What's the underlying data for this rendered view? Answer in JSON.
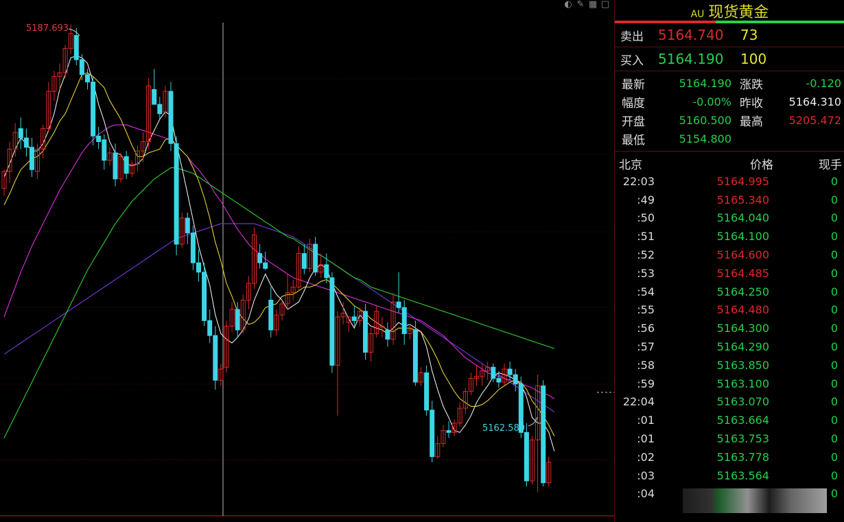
{
  "quote": {
    "symbol_tag": "AU",
    "title": "现货黄金",
    "sell_label": "卖出",
    "sell_price": "5164.740",
    "sell_volume": "73",
    "buy_label": "买入",
    "buy_price": "5164.190",
    "buy_volume": "100",
    "stats": [
      {
        "k": "最新",
        "v": "5164.190",
        "vcolor": "dn",
        "k2": "涨跌",
        "v2": "-0.120",
        "v2color": "dn"
      },
      {
        "k": "幅度",
        "v": "-0.00%",
        "vcolor": "dn",
        "k2": "昨收",
        "v2": "5164.310",
        "v2color": "wh"
      },
      {
        "k": "开盘",
        "v": "5160.500",
        "vcolor": "dn",
        "k2": "最高",
        "v2": "5205.472",
        "v2color": "up"
      },
      {
        "k": "最低",
        "v": "5154.800",
        "vcolor": "dn",
        "k2": "",
        "v2": "",
        "v2color": "wh"
      }
    ],
    "tick_header": {
      "time": "北京",
      "price": "价格",
      "vol": "现手"
    },
    "ticks": [
      {
        "t": "22:03",
        "p": "5164.995",
        "c": "up",
        "v": "0"
      },
      {
        "t": ":49",
        "p": "5165.340",
        "c": "up",
        "v": "0"
      },
      {
        "t": ":50",
        "p": "5164.040",
        "c": "dn",
        "v": "0"
      },
      {
        "t": ":51",
        "p": "5164.100",
        "c": "dn",
        "v": "0"
      },
      {
        "t": ":52",
        "p": "5164.600",
        "c": "up",
        "v": "0"
      },
      {
        "t": ":53",
        "p": "5164.485",
        "c": "up",
        "v": "0"
      },
      {
        "t": ":54",
        "p": "5164.250",
        "c": "dn",
        "v": "0"
      },
      {
        "t": ":55",
        "p": "5164.480",
        "c": "up",
        "v": "0"
      },
      {
        "t": ":56",
        "p": "5164.300",
        "c": "dn",
        "v": "0"
      },
      {
        "t": ":57",
        "p": "5164.290",
        "c": "dn",
        "v": "0"
      },
      {
        "t": ":58",
        "p": "5163.850",
        "c": "dn",
        "v": "0"
      },
      {
        "t": ":59",
        "p": "5163.100",
        "c": "dn",
        "v": "0"
      },
      {
        "t": "22:04",
        "p": "5163.070",
        "c": "dn",
        "v": "0"
      },
      {
        "t": ":01",
        "p": "5163.664",
        "c": "dn",
        "v": "0"
      },
      {
        "t": ":01",
        "p": "5163.753",
        "c": "dn",
        "v": "0"
      },
      {
        "t": ":02",
        "p": "5163.778",
        "c": "dn",
        "v": "0"
      },
      {
        "t": ":03",
        "p": "5163.564",
        "c": "dn",
        "v": "0"
      },
      {
        "t": ":04",
        "p": "",
        "c": "dn",
        "v": "0"
      }
    ]
  },
  "colors": {
    "up": "#e02828",
    "down": "#3cd6e6",
    "ma5": "#e8e8e8",
    "ma10": "#e8d030",
    "ma20": "#e030e0",
    "ma40": "#30d030",
    "ma60": "#7a3ae0"
  },
  "chart_data": {
    "type": "candlestick",
    "high_label": "5187.693",
    "low_label": "5162.580",
    "ylim": [
      5161.4,
      5189.0
    ],
    "candles": [
      [
        5178.9,
        5179.9,
        5178.5,
        5179.8
      ],
      [
        5179.8,
        5181.4,
        5179.2,
        5181.0
      ],
      [
        5181.0,
        5182.4,
        5180.6,
        5181.9
      ],
      [
        5182.1,
        5182.7,
        5181.0,
        5181.6
      ],
      [
        5181.6,
        5182.1,
        5180.6,
        5181.1
      ],
      [
        5181.1,
        5181.6,
        5179.5,
        5179.9
      ],
      [
        5179.8,
        5181.3,
        5179.4,
        5181.0
      ],
      [
        5181.0,
        5182.3,
        5180.5,
        5182.1
      ],
      [
        5182.1,
        5184.6,
        5181.9,
        5184.1
      ],
      [
        5184.1,
        5185.2,
        5183.6,
        5184.9
      ],
      [
        5184.9,
        5185.6,
        5184.2,
        5185.1
      ],
      [
        5185.1,
        5186.6,
        5184.8,
        5186.4
      ],
      [
        5186.4,
        5187.693,
        5186.1,
        5187.2
      ],
      [
        5187.1,
        5187.5,
        5185.5,
        5185.8
      ],
      [
        5185.8,
        5186.1,
        5184.7,
        5185.0
      ],
      [
        5185.0,
        5185.3,
        5184.2,
        5184.6
      ],
      [
        5184.6,
        5184.9,
        5181.2,
        5181.7
      ],
      [
        5181.7,
        5182.2,
        5181.0,
        5181.4
      ],
      [
        5181.5,
        5181.8,
        5179.9,
        5180.4
      ],
      [
        5180.4,
        5181.1,
        5180.1,
        5180.8
      ],
      [
        5180.8,
        5181.3,
        5179.0,
        5179.4
      ],
      [
        5179.4,
        5180.8,
        5179.2,
        5180.6
      ],
      [
        5180.6,
        5180.9,
        5179.4,
        5179.7
      ],
      [
        5179.7,
        5180.4,
        5179.5,
        5180.2
      ],
      [
        5180.2,
        5181.2,
        5179.8,
        5180.9
      ],
      [
        5180.9,
        5181.9,
        5180.3,
        5181.4
      ],
      [
        5181.4,
        5184.8,
        5181.0,
        5184.4
      ],
      [
        5184.2,
        5185.3,
        5183.8,
        5183.4
      ],
      [
        5183.4,
        5183.8,
        5182.6,
        5182.9
      ],
      [
        5183.0,
        5184.4,
        5182.7,
        5184.1
      ],
      [
        5184.1,
        5184.6,
        5180.9,
        5181.3
      ],
      [
        5181.3,
        5181.7,
        5175.3,
        5175.9
      ],
      [
        5175.9,
        5177.6,
        5175.7,
        5177.3
      ],
      [
        5177.3,
        5177.6,
        5175.9,
        5176.5
      ],
      [
        5176.5,
        5176.9,
        5174.5,
        5174.9
      ],
      [
        5174.9,
        5175.6,
        5173.9,
        5174.4
      ],
      [
        5174.4,
        5174.9,
        5171.5,
        5171.8
      ],
      [
        5171.8,
        5172.4,
        5170.6,
        5171.0
      ],
      [
        5171.0,
        5171.5,
        5168.1,
        5168.6
      ],
      [
        5168.6,
        5169.5,
        5168.3,
        5169.2
      ],
      [
        5169.3,
        5171.8,
        5169.0,
        5171.5
      ],
      [
        5171.5,
        5172.8,
        5171.2,
        5172.4
      ],
      [
        5172.4,
        5172.8,
        5170.9,
        5171.3
      ],
      [
        5171.3,
        5173.2,
        5171.1,
        5172.9
      ],
      [
        5172.9,
        5174.2,
        5172.4,
        5173.8
      ],
      [
        5173.8,
        5176.8,
        5173.5,
        5176.4
      ],
      [
        5175.4,
        5175.9,
        5174.6,
        5174.9
      ],
      [
        5174.9,
        5175.5,
        5174.5,
        5174.6
      ],
      [
        5172.9,
        5173.6,
        5170.9,
        5171.3
      ],
      [
        5171.3,
        5172.4,
        5171.0,
        5172.1
      ],
      [
        5172.1,
        5172.9,
        5171.8,
        5172.7
      ],
      [
        5172.7,
        5174.3,
        5172.4,
        5173.3
      ],
      [
        5173.3,
        5174.0,
        5172.9,
        5173.6
      ],
      [
        5173.6,
        5175.8,
        5173.4,
        5175.4
      ],
      [
        5175.4,
        5175.9,
        5174.3,
        5174.6
      ],
      [
        5174.6,
        5176.2,
        5174.4,
        5175.9
      ],
      [
        5175.9,
        5176.3,
        5174.2,
        5174.4
      ],
      [
        5174.4,
        5175.4,
        5174.1,
        5174.8
      ],
      [
        5174.8,
        5175.4,
        5173.8,
        5174.1
      ],
      [
        5174.1,
        5174.4,
        5169.0,
        5169.4
      ],
      [
        5169.4,
        5172.3,
        5166.7,
        5172.0
      ],
      [
        5172.0,
        5172.8,
        5171.6,
        5172.2
      ],
      [
        5171.7,
        5172.0,
        5171.2,
        5172.0
      ],
      [
        5172.0,
        5172.6,
        5171.5,
        5171.8
      ],
      [
        5171.8,
        5172.5,
        5171.5,
        5172.3
      ],
      [
        5172.3,
        5172.7,
        5169.7,
        5170.1
      ],
      [
        5170.1,
        5171.4,
        5169.6,
        5171.1
      ],
      [
        5171.1,
        5172.6,
        5170.9,
        5172.3
      ],
      [
        5171.5,
        5172.0,
        5170.9,
        5171.5
      ],
      [
        5171.3,
        5171.7,
        5170.4,
        5170.8
      ],
      [
        5170.8,
        5173.3,
        5170.5,
        5172.8
      ],
      [
        5172.8,
        5174.4,
        5172.2,
        5172.5
      ],
      [
        5172.5,
        5172.9,
        5170.5,
        5171.1
      ],
      [
        5171.1,
        5171.6,
        5170.8,
        5171.3
      ],
      [
        5171.3,
        5171.8,
        5168.3,
        5168.5
      ],
      [
        5168.5,
        5169.3,
        5168.3,
        5169.0
      ],
      [
        5169.0,
        5169.4,
        5166.7,
        5167.0
      ],
      [
        5167.0,
        5167.5,
        5164.2,
        5164.5
      ],
      [
        5164.5,
        5165.6,
        5164.4,
        5165.2
      ],
      [
        5165.2,
        5166.2,
        5165.0,
        5165.9
      ],
      [
        5165.9,
        5166.4,
        5165.5,
        5165.8
      ],
      [
        5165.8,
        5166.5,
        5165.6,
        5166.3
      ],
      [
        5166.3,
        5167.4,
        5166.1,
        5167.1
      ],
      [
        5167.1,
        5168.2,
        5166.8,
        5168.0
      ],
      [
        5168.0,
        5169.0,
        5167.8,
        5168.7
      ],
      [
        5168.7,
        5169.4,
        5168.3,
        5168.8
      ],
      [
        5168.8,
        5169.5,
        5168.3,
        5169.1
      ],
      [
        5169.1,
        5169.6,
        5168.6,
        5169.3
      ],
      [
        5169.3,
        5169.5,
        5168.5,
        5168.7
      ],
      [
        5168.7,
        5169.1,
        5168.2,
        5168.5
      ],
      [
        5168.5,
        5169.5,
        5168.3,
        5169.2
      ],
      [
        5169.2,
        5169.6,
        5168.6,
        5168.9
      ],
      [
        5168.9,
        5169.2,
        5168.0,
        5168.4
      ],
      [
        5168.4,
        5168.8,
        5165.5,
        5165.8
      ],
      [
        5165.8,
        5166.3,
        5162.9,
        5163.2
      ],
      [
        5163.2,
        5165.6,
        5163.0,
        5165.4
      ],
      [
        5165.4,
        5168.9,
        5162.58,
        5168.3
      ],
      [
        5168.3,
        5168.6,
        5162.9,
        5163.1
      ],
      [
        5163.1,
        5164.5,
        5162.9,
        5164.2
      ]
    ],
    "ma5": [
      5179.5,
      5180.2,
      5181.0,
      5181.6,
      5181.3,
      5180.9,
      5180.9,
      5181.3,
      5182.0,
      5182.9,
      5184.2,
      5185.0,
      5185.9,
      5186.0,
      5185.9,
      5185.6,
      5184.6,
      5183.4,
      5182.5,
      5181.4,
      5180.8,
      5180.7,
      5180.2,
      5180.1,
      5180.2,
      5180.5,
      5181.4,
      5182.0,
      5182.6,
      5183.0,
      5182.8,
      5181.3,
      5180.0,
      5178.6,
      5177.2,
      5175.8,
      5174.7,
      5173.7,
      5172.1,
      5171.1,
      5170.8,
      5170.6,
      5170.9,
      5171.3,
      5171.9,
      5172.9,
      5173.6,
      5174.3,
      5173.7,
      5173.2,
      5172.9,
      5172.4,
      5172.6,
      5172.8,
      5173.4,
      5174.1,
      5174.6,
      5174.8,
      5174.6,
      5173.8,
      5173.1,
      5172.5,
      5171.9,
      5171.4,
      5172.1,
      5171.8,
      5171.5,
      5171.4,
      5171.3,
      5171.1,
      5171.4,
      5171.7,
      5171.5,
      5171.6,
      5171.4,
      5171.2,
      5170.4,
      5169.1,
      5168.1,
      5167.2,
      5166.6,
      5165.9,
      5165.8,
      5166.2,
      5166.7,
      5167.4,
      5167.9,
      5168.3,
      5168.8,
      5169.0,
      5168.9,
      5168.8,
      5168.6,
      5168.4,
      5167.7,
      5166.6,
      5166.3,
      5166.3,
      5165.8,
      5164.8
    ],
    "ma10": [
      5178.0,
      5178.6,
      5179.3,
      5179.9,
      5180.2,
      5180.5,
      5180.6,
      5180.9,
      5181.4,
      5181.9,
      5182.5,
      5182.9,
      5183.6,
      5184.3,
      5185.0,
      5185.1,
      5184.9,
      5184.6,
      5184.3,
      5183.6,
      5183.1,
      5182.6,
      5181.9,
      5181.2,
      5180.6,
      5180.6,
      5180.8,
      5180.9,
      5181.0,
      5181.5,
      5181.6,
      5181.2,
      5180.9,
      5180.6,
      5180.0,
      5179.3,
      5178.4,
      5177.3,
      5176.0,
      5175.0,
      5173.8,
      5173.1,
      5172.3,
      5171.9,
      5171.6,
      5171.7,
      5172.0,
      5172.5,
      5172.6,
      5172.7,
      5173.1,
      5173.2,
      5173.2,
      5173.4,
      5173.6,
      5173.6,
      5173.7,
      5173.9,
      5174.0,
      5173.8,
      5173.5,
      5173.2,
      5172.9,
      5172.6,
      5172.4,
      5172.2,
      5171.9,
      5171.7,
      5171.5,
      5171.3,
      5171.2,
      5171.4,
      5171.4,
      5171.4,
      5171.3,
      5171.2,
      5170.8,
      5170.3,
      5169.7,
      5169.0,
      5168.5,
      5168.0,
      5167.6,
      5167.4,
      5167.2,
      5167.2,
      5167.3,
      5167.5,
      5167.8,
      5168.1,
      5168.3,
      5168.5,
      5168.6,
      5168.5,
      5168.1,
      5167.5,
      5167.1,
      5166.7,
      5166.2,
      5165.6
    ],
    "ma20": [
      5172.0,
      5172.8,
      5173.6,
      5174.4,
      5175.1,
      5175.8,
      5176.4,
      5177.0,
      5177.6,
      5178.2,
      5178.8,
      5179.3,
      5179.8,
      5180.3,
      5180.8,
      5181.2,
      5181.5,
      5181.8,
      5182.0,
      5182.2,
      5182.3,
      5182.3,
      5182.3,
      5182.2,
      5182.1,
      5182.0,
      5181.9,
      5181.8,
      5181.7,
      5181.6,
      5181.5,
      5181.2,
      5180.9,
      5180.6,
      5180.2,
      5179.9,
      5179.5,
      5179.1,
      5178.6,
      5178.2,
      5177.7,
      5177.2,
      5176.7,
      5176.3,
      5175.9,
      5175.6,
      5175.4,
      5175.1,
      5174.9,
      5174.7,
      5174.5,
      5174.3,
      5174.1,
      5174.0,
      5173.9,
      5173.8,
      5173.7,
      5173.6,
      5173.5,
      5173.4,
      5173.3,
      5173.2,
      5173.1,
      5173.0,
      5172.9,
      5172.8,
      5172.7,
      5172.6,
      5172.5,
      5172.4,
      5172.3,
      5172.2,
      5172.1,
      5172.0,
      5171.9,
      5171.8,
      5171.6,
      5171.4,
      5171.2,
      5171.0,
      5170.7,
      5170.4,
      5170.1,
      5169.8,
      5169.6,
      5169.4,
      5169.2,
      5169.0,
      5168.9,
      5168.8,
      5168.7,
      5168.6,
      5168.5,
      5168.4,
      5168.3,
      5168.2,
      5168.0,
      5167.9,
      5167.8,
      5167.6
    ],
    "ma40": [
      5165.5,
      5166.1,
      5166.7,
      5167.3,
      5167.9,
      5168.5,
      5169.1,
      5169.7,
      5170.3,
      5170.9,
      5171.5,
      5172.1,
      5172.7,
      5173.3,
      5173.9,
      5174.5,
      5175.0,
      5175.5,
      5176.0,
      5176.5,
      5177.0,
      5177.4,
      5177.8,
      5178.2,
      5178.5,
      5178.8,
      5179.1,
      5179.4,
      5179.6,
      5179.8,
      5180.0,
      5180.0,
      5179.9,
      5179.8,
      5179.7,
      5179.5,
      5179.3,
      5179.1,
      5178.9,
      5178.7,
      5178.5,
      5178.3,
      5178.1,
      5177.9,
      5177.7,
      5177.5,
      5177.3,
      5177.1,
      5176.9,
      5176.7,
      5176.5,
      5176.3,
      5176.2,
      5176.0,
      5175.8,
      5175.6,
      5175.4,
      5175.3,
      5175.1,
      5174.9,
      5174.7,
      5174.5,
      5174.3,
      5174.1,
      5174.0,
      5173.8,
      5173.6,
      5173.5,
      5173.4,
      5173.3,
      5173.2,
      5173.1,
      5173.0,
      5172.9,
      5172.8,
      5172.7,
      5172.6,
      5172.5,
      5172.4,
      5172.3,
      5172.2,
      5172.1,
      5172.0,
      5171.9,
      5171.8,
      5171.7,
      5171.6,
      5171.5,
      5171.4,
      5171.3,
      5171.2,
      5171.1,
      5171.0,
      5170.9,
      5170.8,
      5170.7,
      5170.6,
      5170.5,
      5170.4,
      5170.3
    ],
    "ma60": [
      5170.0,
      5170.2,
      5170.4,
      5170.6,
      5170.8,
      5171.0,
      5171.2,
      5171.4,
      5171.6,
      5171.8,
      5172.0,
      5172.2,
      5172.4,
      5172.6,
      5172.8,
      5173.0,
      5173.2,
      5173.4,
      5173.6,
      5173.8,
      5174.0,
      5174.2,
      5174.4,
      5174.6,
      5174.8,
      5175.0,
      5175.2,
      5175.4,
      5175.6,
      5175.8,
      5176.0,
      5176.2,
      5176.3,
      5176.4,
      5176.5,
      5176.6,
      5176.7,
      5176.8,
      5176.9,
      5177.0,
      5177.0,
      5177.0,
      5177.0,
      5177.0,
      5177.0,
      5177.0,
      5176.9,
      5176.8,
      5176.7,
      5176.6,
      5176.5,
      5176.4,
      5176.3,
      5176.1,
      5175.9,
      5175.7,
      5175.5,
      5175.3,
      5175.1,
      5174.9,
      5174.7,
      5174.5,
      5174.3,
      5174.1,
      5173.9,
      5173.7,
      5173.5,
      5173.3,
      5173.1,
      5172.9,
      5172.7,
      5172.5,
      5172.3,
      5172.1,
      5171.9,
      5171.7,
      5171.5,
      5171.3,
      5171.1,
      5170.9,
      5170.7,
      5170.5,
      5170.3,
      5170.1,
      5169.9,
      5169.7,
      5169.5,
      5169.3,
      5169.1,
      5168.9,
      5168.7,
      5168.5,
      5168.3,
      5168.1,
      5167.9,
      5167.7,
      5167.5,
      5167.3,
      5167.1,
      5166.9
    ]
  }
}
